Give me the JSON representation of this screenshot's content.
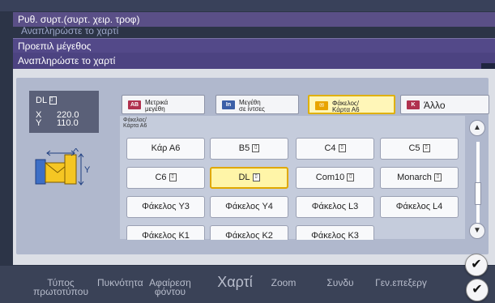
{
  "bg": {
    "bottom_items": [
      "Τύπος πρωτοτύπου",
      "Πυκνότητα",
      "Αφαίρεση φόντου",
      "Χαρτί",
      "Zoom",
      "Συνδυ",
      "Γεν.επεξεργ"
    ]
  },
  "titles": {
    "t1": "Ρυθ. συρτ.(συρτ. χειρ. τροφ)",
    "ghost": "Αναπληρώστε το χαρτί",
    "t2": "Προεπιλ μέγεθος",
    "t3": "Αναπληρώστε το χαρτί"
  },
  "info": {
    "size": "DL",
    "x_label": "X",
    "y_label": "Y",
    "x_value": "220.0",
    "y_value": "110.0"
  },
  "tabs": [
    {
      "label_line1": "Μετρικά",
      "label_line2": "μεγέθη",
      "icon": "AB"
    },
    {
      "label_line1": "Μεγέθη",
      "label_line2": "σε ίντσες",
      "icon": "In"
    },
    {
      "label_line1": "Φάκελος/",
      "label_line2": "Κάρτα Α6",
      "icon": "envelope-icon"
    },
    {
      "label": "Άλλο",
      "icon": "K"
    }
  ],
  "category": {
    "line1": "Φάκελος/",
    "line2": "Κάρτα Α6"
  },
  "buttons": [
    {
      "label": "Κάρ Α6"
    },
    {
      "label": "B5"
    },
    {
      "label": "C4"
    },
    {
      "label": "C5"
    },
    {
      "label": "C6"
    },
    {
      "label": "DL"
    },
    {
      "label": "Com10"
    },
    {
      "label": "Monarch"
    },
    {
      "label": "Φάκελος Y3"
    },
    {
      "label": "Φάκελος Y4"
    },
    {
      "label": "Φάκελος L3"
    },
    {
      "label": "Φάκελος L4"
    },
    {
      "label": "Φάκελος K1"
    },
    {
      "label": "Φάκελος K2"
    },
    {
      "label": "Φάκελος K3"
    }
  ],
  "colors": {
    "accent_selected": "#fff5a8",
    "accent_selected_border": "#e0a800",
    "title_bar": "#534989"
  }
}
